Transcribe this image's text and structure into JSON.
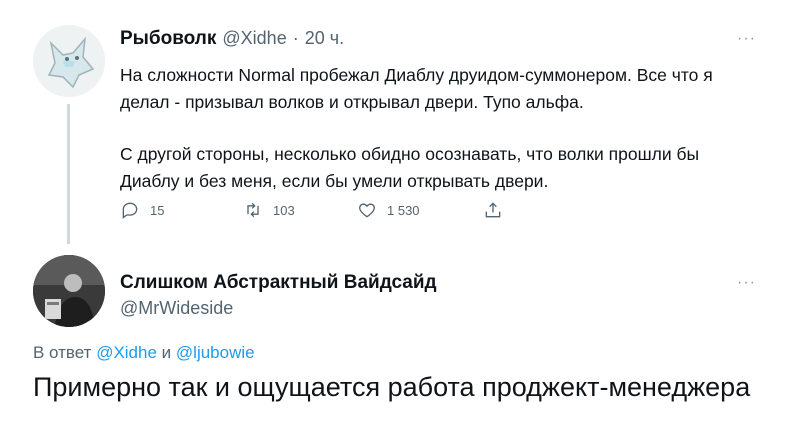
{
  "tweet1": {
    "author_name": "Рыбоволк",
    "author_handle": "@Xidhe",
    "separator": "·",
    "time": "20 ч.",
    "more_icon": "ellipsis-icon",
    "paragraph1": "На сложности Normal пробежал Диаблу друидом-суммонером. Все что я делал - призывал волков и открывал двери. Тупо альфа.",
    "paragraph2": "С другой стороны, несколько обидно осознавать, что волки прошли бы Диаблу и без меня, если бы умели открывать двери.",
    "actions": {
      "replies": "15",
      "retweets": "103",
      "likes": "1 530"
    }
  },
  "tweet2": {
    "author_name": "Слишком Абстрактный Вайдсайд",
    "author_handle": "@MrWideside",
    "more_icon": "ellipsis-icon",
    "reply_prefix": "В ответ",
    "reply_user1": "@Xidhe",
    "reply_and": "и",
    "reply_user2": "@ljubowie",
    "text": "Примерно так и ощущается работа проджект-менеджера"
  },
  "colors": {
    "link": "#1d9bf0",
    "secondary_text": "#536471",
    "thread_line": "#cfd9de"
  }
}
